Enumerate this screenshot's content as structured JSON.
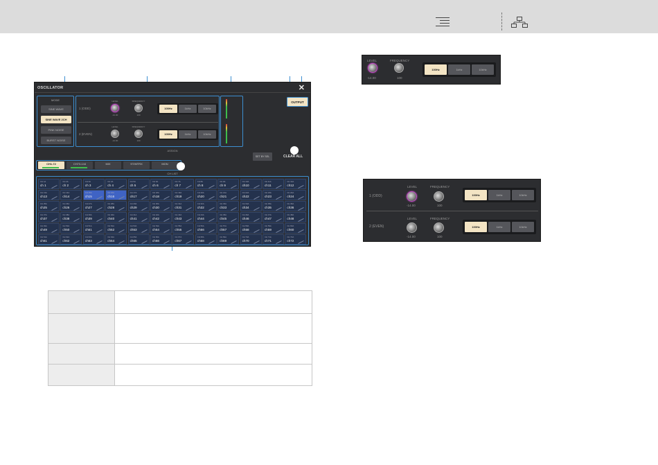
{
  "screen": {
    "title": "OSCILLATOR",
    "mode": {
      "label": "MODE",
      "buttons": [
        "SINE WAVE",
        "SINE WAVE 2CH",
        "PINK NOISE",
        "BURST NOISE"
      ],
      "selected": "SINE WAVE 2CH"
    },
    "osc": {
      "level_label": "LEVEL",
      "frequency_label": "FREQUENCY",
      "rows": [
        {
          "label": "1 (ODD)",
          "level_value": "-14.00",
          "freq_value": "100",
          "freq_buttons": [
            "100Hz",
            "1kHz",
            "10kHz"
          ],
          "selected": "100Hz"
        },
        {
          "label": "2 (EVEN)",
          "level_value": "-14.00",
          "freq_value": "100",
          "freq_buttons": [
            "100Hz",
            "1kHz",
            "10kHz"
          ],
          "selected": "100Hz"
        }
      ]
    },
    "output_label": "OUTPUT",
    "assign_label": "ASSIGN",
    "set_by_sel_label": "SET BY SEL",
    "clear_all_label": "CLEAR ALL",
    "tabs": [
      "CH1-72",
      "CH73-144",
      "MIX",
      "ST/MTRX",
      "MON"
    ],
    "selected_tab": "CH1-72",
    "channel_list_label": "CH LIST",
    "channel_rows": [
      {
        "subs": [
          "CH 1A",
          "CH 2A",
          "CH 3A",
          "CH 4A",
          "CH 5A",
          "CH 6A",
          "CH 7A",
          "CH 8A",
          "CH 9A",
          "CH 10A",
          "CH 11A",
          "CH 12A"
        ],
        "names": [
          "ch 1",
          "ch 2",
          "ch 3",
          "ch 4",
          "ch 5",
          "ch 6",
          "ch 7",
          "ch 8",
          "ch 9",
          "ch10",
          "ch11",
          "ch12"
        ]
      },
      {
        "subs": [
          "CH 13A",
          "CH 14A",
          "CH 15A",
          "CH 16A",
          "CH 17A",
          "CH 18A",
          "CH 19A",
          "CH 20A",
          "CH 21A",
          "CH 22A",
          "CH 23A",
          "CH 24A"
        ],
        "names": [
          "ch13",
          "ch14",
          "ch15",
          "ch16",
          "ch17",
          "ch18",
          "ch19",
          "ch20",
          "ch21",
          "ch22",
          "ch23",
          "ch24"
        ]
      },
      {
        "subs": [
          "CH 25A",
          "CH 26A",
          "CH 27A",
          "CH 28A",
          "CH 29A",
          "CH 30A",
          "CH 31A",
          "CH 32A",
          "CH 33A",
          "CH 34A",
          "CH 35A",
          "CH 36A"
        ],
        "names": [
          "ch25",
          "ch26",
          "ch27",
          "ch28",
          "ch29",
          "ch30",
          "ch31",
          "ch32",
          "ch33",
          "ch34",
          "ch35",
          "ch36"
        ]
      },
      {
        "subs": [
          "CH 37A",
          "CH 38A",
          "CH 39A",
          "CH 40A",
          "CH 41A",
          "CH 42A",
          "CH 43A",
          "CH 44A",
          "CH 45A",
          "CH 46A",
          "CH 47A",
          "CH 48A"
        ],
        "names": [
          "ch37",
          "ch38",
          "ch39",
          "ch40",
          "ch41",
          "ch42",
          "ch43",
          "ch44",
          "ch45",
          "ch46",
          "ch47",
          "ch48"
        ]
      },
      {
        "subs": [
          "CH 49A",
          "CH 50A",
          "CH 51A",
          "CH 52A",
          "CH 53A",
          "CH 54A",
          "CH 55A",
          "CH 56A",
          "CH 57A",
          "CH 58A",
          "CH 59A",
          "CH 60A"
        ],
        "names": [
          "ch49",
          "ch50",
          "ch51",
          "ch52",
          "ch53",
          "ch54",
          "ch55",
          "ch56",
          "ch57",
          "ch58",
          "ch59",
          "ch60"
        ]
      },
      {
        "subs": [
          "CH 61A",
          "CH 62A",
          "CH 63A",
          "CH 64A",
          "CH 65A",
          "CH 66A",
          "CH 67A",
          "CH 68A",
          "CH 69A",
          "CH 70A",
          "CH 71A",
          "CH 72A"
        ],
        "names": [
          "ch61",
          "ch62",
          "ch63",
          "ch64",
          "ch65",
          "ch66",
          "ch67",
          "ch68",
          "ch69",
          "ch70",
          "ch71",
          "ch72"
        ]
      }
    ],
    "selected_channels": [
      "ch15",
      "ch16"
    ]
  },
  "detail1": {
    "level_label": "LEVEL",
    "frequency_label": "FREQUENCY",
    "level_value": "-14.00",
    "freq_value": "100",
    "freq_buttons": [
      "100Hz",
      "1kHz",
      "10kHz"
    ],
    "selected": "100Hz"
  },
  "detail2": {
    "level_label": "LEVEL",
    "frequency_label": "FREQUENCY",
    "rows": [
      {
        "label": "1 (ODD)",
        "level_value": "-14.00",
        "freq_value": "100",
        "freq_buttons": [
          "100Hz",
          "1kHz",
          "10kHz"
        ],
        "selected": "100Hz"
      },
      {
        "label": "2 (EVEN)",
        "level_value": "-14.00",
        "freq_value": "100",
        "freq_buttons": [
          "100Hz",
          "1kHz",
          "10kHz"
        ],
        "selected": "100Hz"
      }
    ]
  },
  "colors": {
    "accent": "#3d8fd1",
    "panel": "#2c2d30",
    "button_on": "#f3e4c4",
    "level_knob_ring": "#c34ac7",
    "channel_selected": "#3f63c4",
    "channel_cell": "#24324d"
  }
}
